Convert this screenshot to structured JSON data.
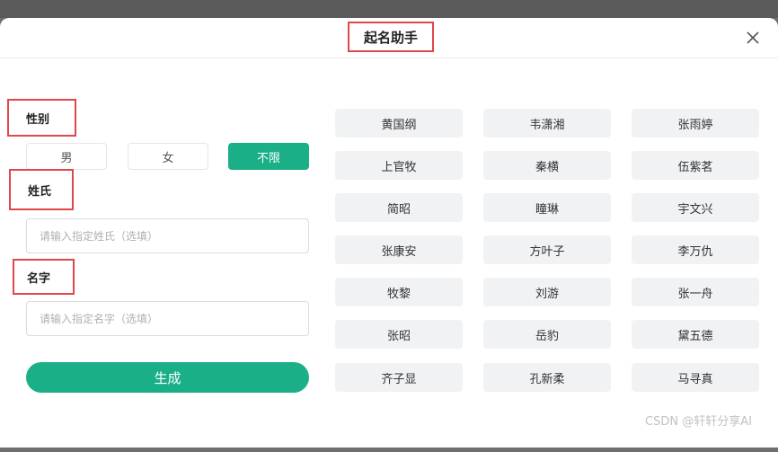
{
  "dialog": {
    "title": "起名助手"
  },
  "form": {
    "gender_label": "性别",
    "gender_options": [
      "男",
      "女",
      "不限"
    ],
    "gender_selected": "不限",
    "surname_label": "姓氏",
    "surname_placeholder": "请输入指定姓氏（选填）",
    "given_name_label": "名字",
    "given_name_placeholder": "请输入指定名字（选填）",
    "generate_label": "生成"
  },
  "results": {
    "names": [
      "黄国纲",
      "韦潇湘",
      "张雨婷",
      "上官牧",
      "秦横",
      "伍紫茗",
      "简昭",
      "瞳琳",
      "宇文兴",
      "张康安",
      "方叶子",
      "李万仇",
      "牧黎",
      "刘游",
      "张一舟",
      "张昭",
      "岳豹",
      "黛五德",
      "齐子显",
      "孔新柔",
      "马寻真"
    ]
  },
  "watermark": "CSDN @轩轩分享AI",
  "colors": {
    "accent": "#1aaf87",
    "annotation_border": "#e0474c"
  }
}
